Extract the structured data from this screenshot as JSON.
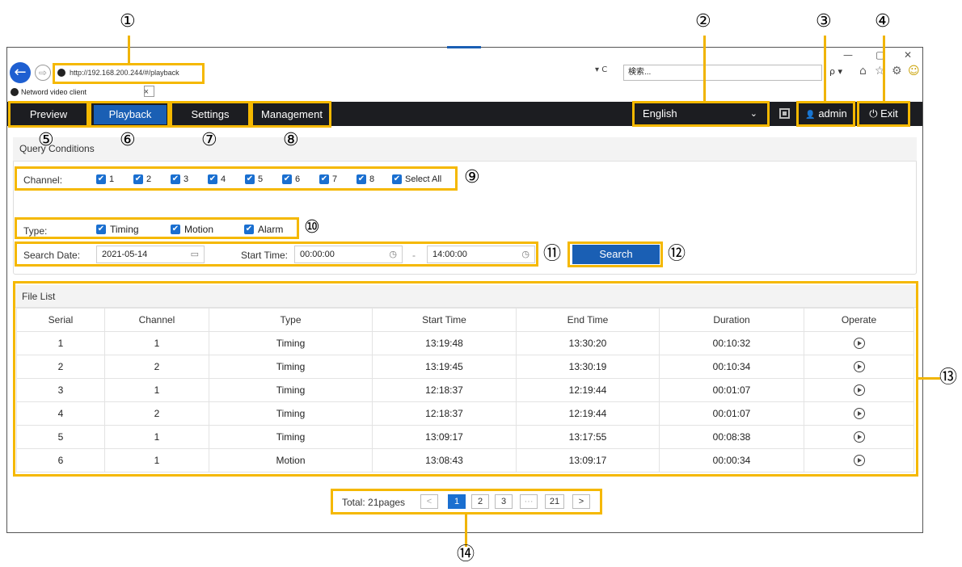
{
  "callouts": [
    "①",
    "②",
    "③",
    "④",
    "⑤",
    "⑥",
    "⑦",
    "⑧",
    "⑨",
    "⑩",
    "⑪",
    "⑫",
    "⑬",
    "⑭"
  ],
  "browser": {
    "window_controls": [
      "—",
      "▢",
      "✕"
    ],
    "back_icon": "←",
    "forward_icon": "⇨",
    "url": "http://192.168.200.244/#/playback",
    "addr_tools": "▾ C",
    "search_placeholder": "検索...",
    "search_btn": "ρ ▾",
    "toolbar_icons": [
      "home-icon",
      "star-icon",
      "gear-icon",
      "smiley-icon"
    ],
    "toolbar_glyphs": [
      "⌂",
      "☆",
      "⚙",
      "☺"
    ],
    "tab_title": "Netword video client",
    "tab_close": "×"
  },
  "nav": {
    "preview": "Preview",
    "playback": "Playback",
    "settings": "Settings",
    "management": "Management",
    "language": "English",
    "language_chevron": "⌄",
    "user": "admin",
    "user_icon": "👤",
    "exit": "Exit",
    "exit_icon": "⏻"
  },
  "query": {
    "title": "Query Conditions",
    "channel_label": "Channel:",
    "channels": [
      "1",
      "2",
      "3",
      "4",
      "5",
      "6",
      "7",
      "8"
    ],
    "select_all": "Select All",
    "type_label": "Type:",
    "types": [
      "Timing",
      "Motion",
      "Alarm"
    ],
    "check_glyph": "✔",
    "search_date_label": "Search Date:",
    "search_date": "2021-05-14",
    "date_icon": "▭",
    "start_time_label": "Start Time:",
    "start_time": "00:00:00",
    "time_sep": "-",
    "end_time": "14:00:00",
    "clock_icon": "◷",
    "search_button": "Search"
  },
  "files": {
    "title": "File List",
    "columns": [
      "Serial",
      "Channel",
      "Type",
      "Start Time",
      "End Time",
      "Duration",
      "Operate"
    ],
    "rows": [
      [
        "1",
        "1",
        "Timing",
        "13:19:48",
        "13:30:20",
        "00:10:32"
      ],
      [
        "2",
        "2",
        "Timing",
        "13:19:45",
        "13:30:19",
        "00:10:34"
      ],
      [
        "3",
        "1",
        "Timing",
        "12:18:37",
        "12:19:44",
        "00:01:07"
      ],
      [
        "4",
        "2",
        "Timing",
        "12:18:37",
        "12:19:44",
        "00:01:07"
      ],
      [
        "5",
        "1",
        "Timing",
        "13:09:17",
        "13:17:55",
        "00:08:38"
      ],
      [
        "6",
        "1",
        "Motion",
        "13:08:43",
        "13:09:17",
        "00:00:34"
      ]
    ]
  },
  "pager": {
    "total": "Total: 21pages",
    "prev": "<",
    "pages": [
      "1",
      "2",
      "3",
      "···",
      "21"
    ],
    "next": ">",
    "current": "1"
  },
  "colors": {
    "highlight": "#f5b800",
    "accent": "#1a5fb4",
    "navbar": "#1c1d21"
  }
}
